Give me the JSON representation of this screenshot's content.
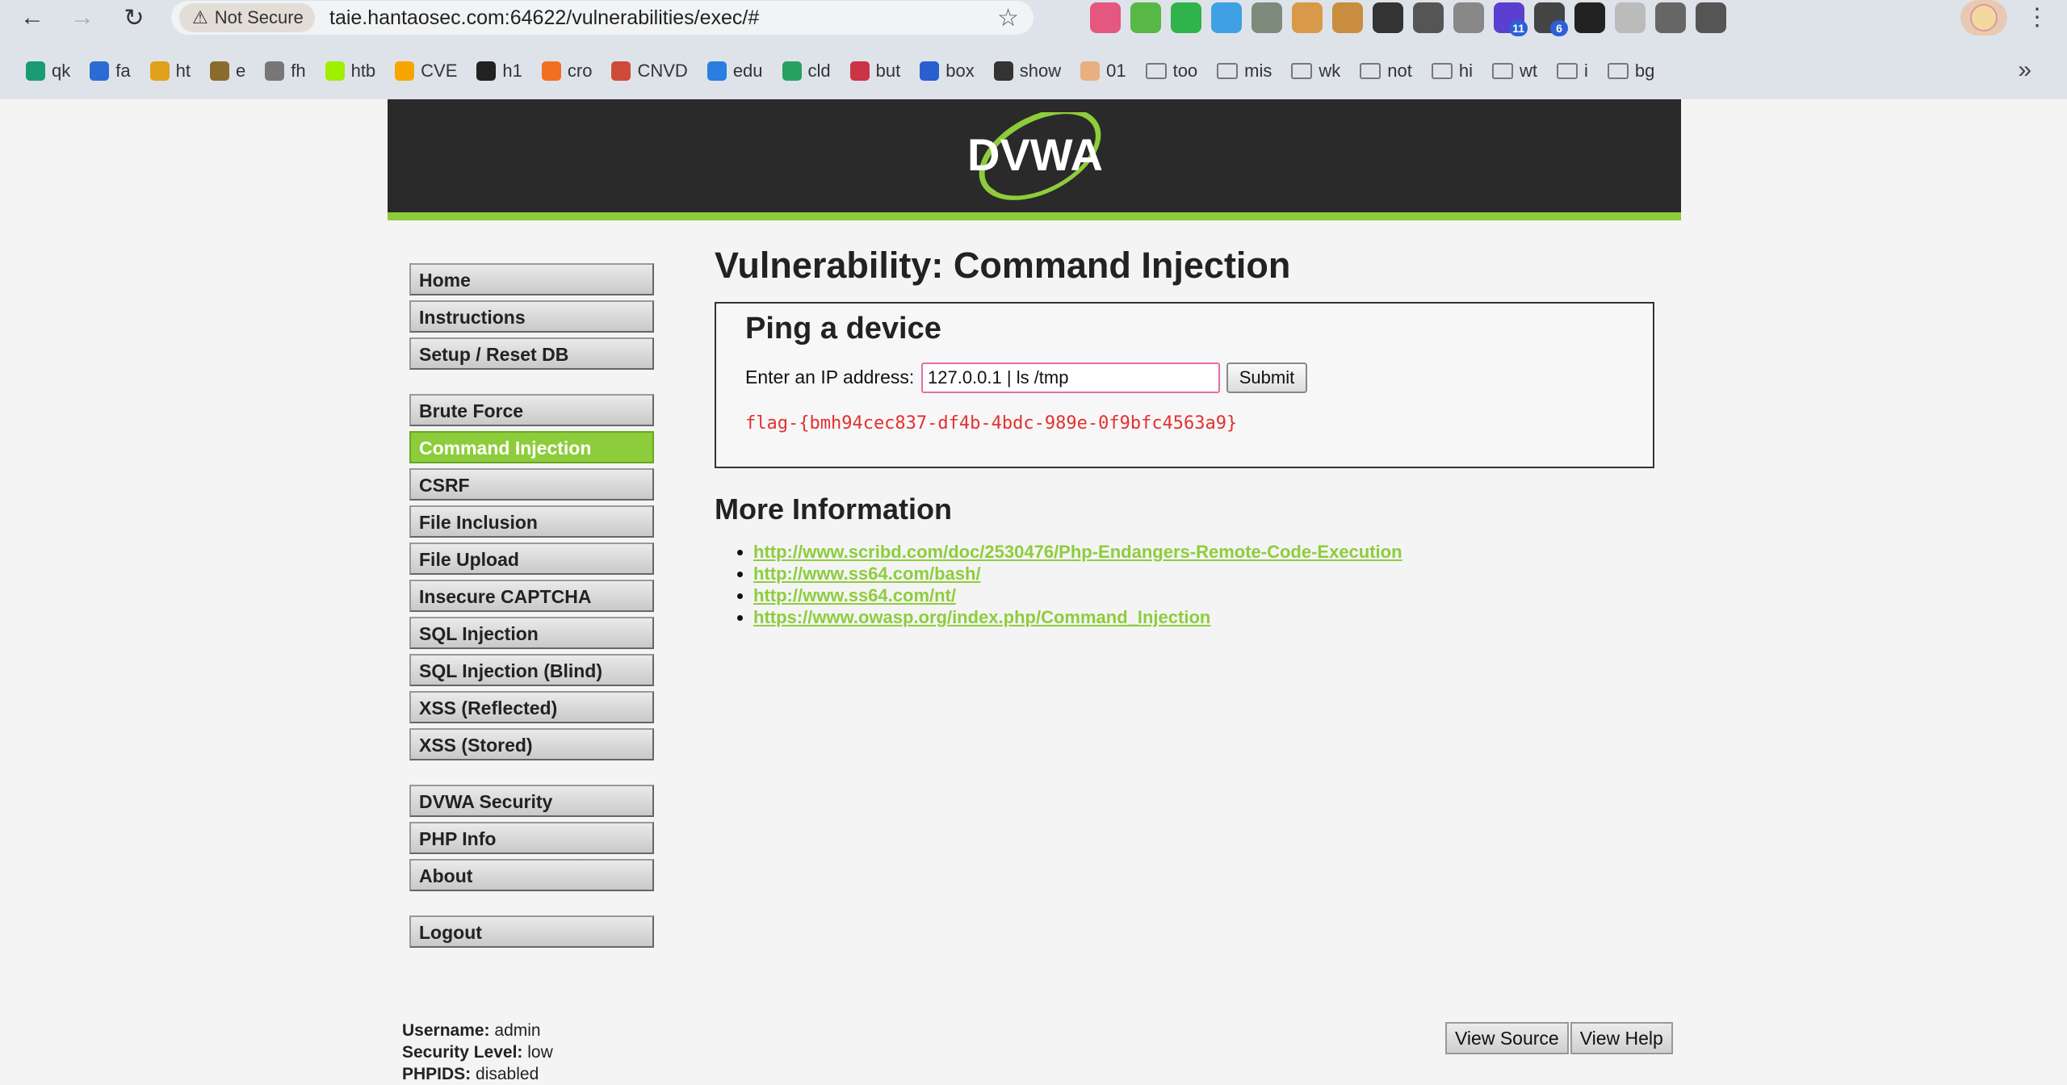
{
  "browser": {
    "security_label": "Not Secure",
    "url": "taie.hantaosec.com:64622/vulnerabilities/exec/#",
    "extensions": [
      {
        "name": "translate-ext",
        "color": "#e4577f",
        "badge": ""
      },
      {
        "name": "leaf-ext",
        "color": "#57b846",
        "badge": ""
      },
      {
        "name": "hack-bar-ext",
        "color": "#2fb34a",
        "badge": ""
      },
      {
        "name": "wappalyzer-ext",
        "color": "#3fa1e3",
        "badge": ""
      },
      {
        "name": "proxy-ext",
        "color": "#7c8b7c",
        "badge": ""
      },
      {
        "name": "puzzle-ext",
        "color": "#d89a4a",
        "badge": ""
      },
      {
        "name": "cookie-ext",
        "color": "#c98d3f",
        "badge": ""
      },
      {
        "name": "hacker-ext",
        "color": "#333333",
        "badge": ""
      },
      {
        "name": "hat-ext",
        "color": "#555555",
        "badge": ""
      },
      {
        "name": "runner-ext",
        "color": "#888888",
        "badge": ""
      },
      {
        "name": "cube-ext",
        "color": "#5b3fd0",
        "badge": "11"
      },
      {
        "name": "qr-ext",
        "color": "#444444",
        "badge": "6"
      },
      {
        "name": "ez-ext",
        "color": "#222222",
        "badge": ""
      },
      {
        "name": "circle-ext",
        "color": "#bbbbbb",
        "badge": ""
      },
      {
        "name": "extensions-ext",
        "color": "#666666",
        "badge": ""
      },
      {
        "name": "spy-ext",
        "color": "#555555",
        "badge": ""
      }
    ],
    "bookmarks": [
      {
        "label": "qk",
        "color": "#1a9c73",
        "folder": false
      },
      {
        "label": "fa",
        "color": "#2b6cd4",
        "folder": false
      },
      {
        "label": "ht",
        "color": "#e0a21a",
        "folder": false
      },
      {
        "label": "e",
        "color": "#8a6b2e",
        "folder": false
      },
      {
        "label": "fh",
        "color": "#777777",
        "folder": false
      },
      {
        "label": "htb",
        "color": "#9fef00",
        "folder": false
      },
      {
        "label": "CVE",
        "color": "#f7a600",
        "folder": false
      },
      {
        "label": "h1",
        "color": "#222222",
        "folder": false
      },
      {
        "label": "cro",
        "color": "#f26f22",
        "folder": false
      },
      {
        "label": "CNVD",
        "color": "#d04a3a",
        "folder": false
      },
      {
        "label": "edu",
        "color": "#2a7de1",
        "folder": false
      },
      {
        "label": "cld",
        "color": "#27a060",
        "folder": false
      },
      {
        "label": "but",
        "color": "#cc3344",
        "folder": false
      },
      {
        "label": "box",
        "color": "#2a5fd0",
        "folder": false
      },
      {
        "label": "show",
        "color": "#333333",
        "folder": false
      },
      {
        "label": "01",
        "color": "#e8b080",
        "folder": false
      },
      {
        "label": "too",
        "color": "",
        "folder": true
      },
      {
        "label": "mis",
        "color": "",
        "folder": true
      },
      {
        "label": "wk",
        "color": "",
        "folder": true
      },
      {
        "label": "not",
        "color": "",
        "folder": true
      },
      {
        "label": "hi",
        "color": "",
        "folder": true
      },
      {
        "label": "wt",
        "color": "",
        "folder": true
      },
      {
        "label": "i",
        "color": "",
        "folder": true
      },
      {
        "label": "bg",
        "color": "",
        "folder": true
      }
    ]
  },
  "header": {
    "logo_text": "DVWA"
  },
  "menu": {
    "blocks": [
      [
        "Home",
        "Instructions",
        "Setup / Reset DB"
      ],
      [
        "Brute Force",
        "Command Injection",
        "CSRF",
        "File Inclusion",
        "File Upload",
        "Insecure CAPTCHA",
        "SQL Injection",
        "SQL Injection (Blind)",
        "XSS (Reflected)",
        "XSS (Stored)"
      ],
      [
        "DVWA Security",
        "PHP Info",
        "About"
      ],
      [
        "Logout"
      ]
    ],
    "active": "Command Injection"
  },
  "main": {
    "title": "Vulnerability: Command Injection",
    "box_title": "Ping a device",
    "ip_label": "Enter an IP address:",
    "ip_value": "127.0.0.1 | ls /tmp",
    "submit_label": "Submit",
    "output": "flag-{bmh94cec837-df4b-4bdc-989e-0f9bfc4563a9}",
    "more_title": "More Information",
    "links": [
      "http://www.scribd.com/doc/2530476/Php-Endangers-Remote-Code-Execution",
      "http://www.ss64.com/bash/",
      "http://www.ss64.com/nt/",
      "https://www.owasp.org/index.php/Command_Injection"
    ]
  },
  "footer": {
    "username_label": "Username:",
    "username": "admin",
    "security_label": "Security Level:",
    "security": "low",
    "phpids_label": "PHPIDS:",
    "phpids": "disabled",
    "view_source": "View Source",
    "view_help": "View Help"
  },
  "colors": {
    "accent": "#8dcd3b",
    "header_bg": "#2a2a2a",
    "output": "#e53030"
  }
}
